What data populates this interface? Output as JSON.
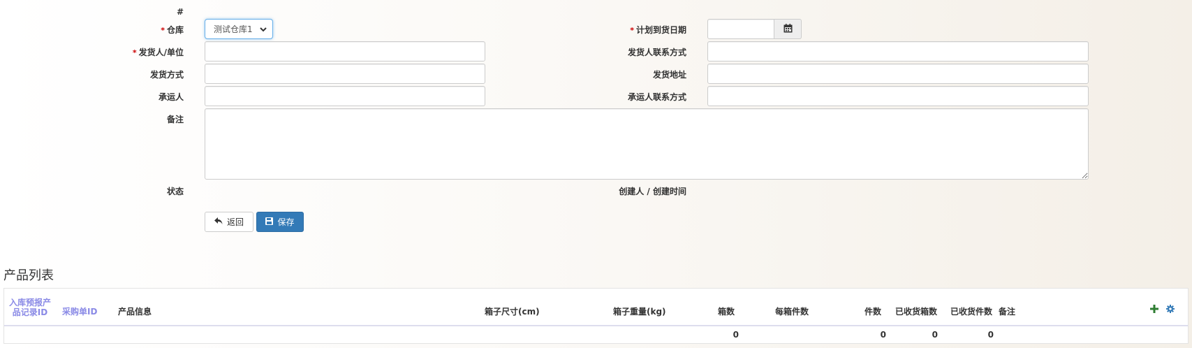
{
  "form": {
    "id_label": "#",
    "warehouse_label": "仓库",
    "warehouse_value": "测试仓库1",
    "planned_date_label": "计划到货日期",
    "planned_date_value": "",
    "shipper_label": "发货人/单位",
    "shipper_contact_label": "发货人联系方式",
    "ship_method_label": "发货方式",
    "ship_address_label": "发货地址",
    "carrier_label": "承运人",
    "carrier_contact_label": "承运人联系方式",
    "remark_label": "备注",
    "status_label": "状态",
    "creator_label": "创建人 / 创建时间",
    "required_mark": "*"
  },
  "buttons": {
    "back_label": "返回",
    "save_label": "保存",
    "back_icon": "reply-icon",
    "save_icon": "floppy-disk-icon"
  },
  "product_section": {
    "title": "产品列表",
    "columns": [
      "入库预报产品记录ID",
      "采购单ID",
      "产品信息",
      "箱子尺寸(cm)",
      "箱子重量(kg)",
      "箱数",
      "每箱件数",
      "件数",
      "已收货箱数",
      "已收货件数",
      "备注"
    ],
    "totals": {
      "boxes": "0",
      "pieces": "0",
      "received_boxes": "0",
      "received_pieces": "0"
    },
    "add_icon": "plus-icon",
    "settings_icon": "gear-icon"
  },
  "colors": {
    "primary": "#337ab7",
    "required": "#cc0000",
    "link_header": "#8a8ae6",
    "add_icon": "#2e7d32"
  }
}
